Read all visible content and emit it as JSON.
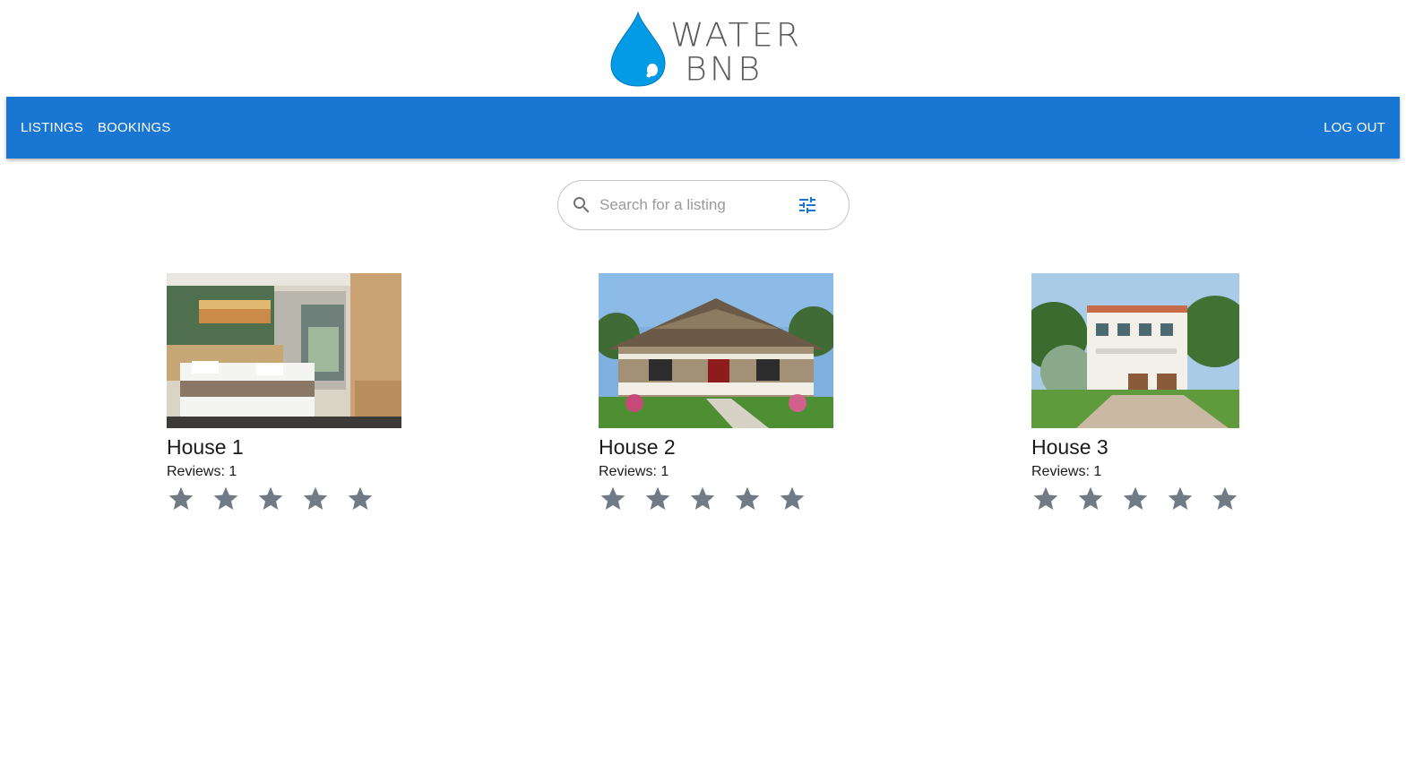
{
  "app": {
    "logo_text_line1": "WATER",
    "logo_text_line2": "BNB",
    "brand_color": "#1976d2",
    "logo_drop_color": "#039be5"
  },
  "nav": {
    "items": [
      {
        "label": "LISTINGS"
      },
      {
        "label": "BOOKINGS"
      }
    ],
    "logout_label": "LOG OUT"
  },
  "search": {
    "placeholder": "Search for a listing",
    "value": "",
    "search_icon": "search-icon",
    "filter_icon": "tune-icon"
  },
  "listings": [
    {
      "title": "House 1",
      "reviews": "Reviews: 1",
      "rating": 0,
      "max_rating": 5,
      "image": "bedroom interior"
    },
    {
      "title": "House 2",
      "reviews": "Reviews: 1",
      "rating": 0,
      "max_rating": 5,
      "image": "craftsman house exterior"
    },
    {
      "title": "House 3",
      "reviews": "Reviews: 1",
      "rating": 0,
      "max_rating": 5,
      "image": "mediterranean villa exterior"
    }
  ],
  "colors": {
    "star_empty": "#707b86"
  }
}
